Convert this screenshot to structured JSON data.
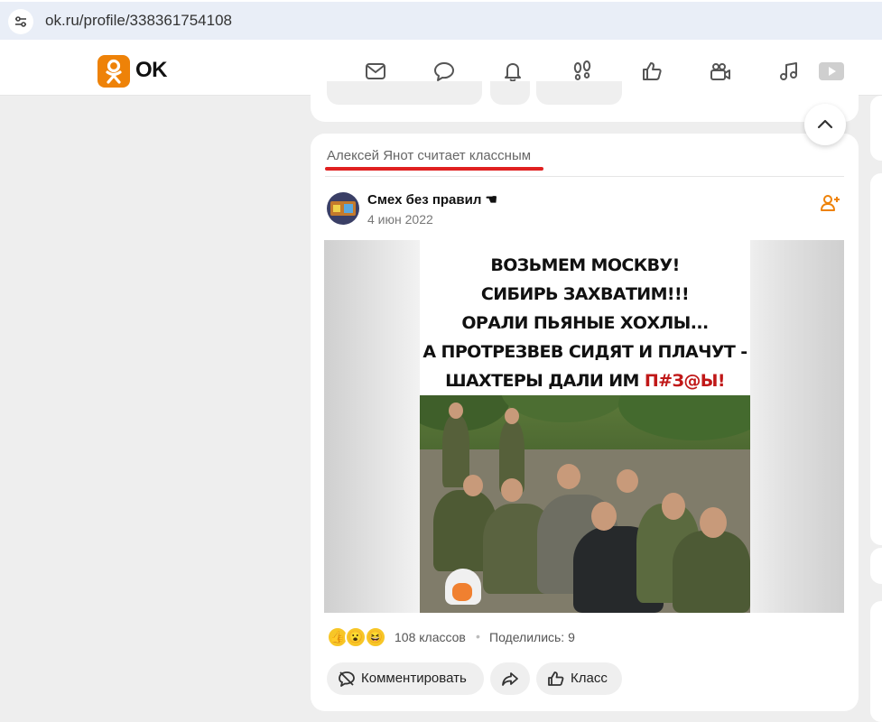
{
  "browser": {
    "url": "ok.ru/profile/338361754108",
    "site_info_icon": "tune-icon"
  },
  "header": {
    "logo_text": "OK",
    "brand_color": "#ee8208",
    "nav_icons": [
      "mail-icon",
      "chat-bubble-icon",
      "bell-icon",
      "footprints-icon",
      "thumbs-up-icon",
      "video-camera-icon",
      "music-note-icon",
      "video-play-icon"
    ]
  },
  "post": {
    "liked_by": "Алексей Янот считает классным",
    "group_name": "Смех без правил",
    "group_name_suffix": "☚",
    "date": "4 июн 2022",
    "image_caption_lines": [
      "ВОЗЬМЕМ МОСКВУ!",
      "СИБИРЬ ЗАХВАТИМ!!!",
      "ОРАЛИ ПЬЯНЫЕ ХОХЛЫ...",
      "А ПРОТРЕЗВЕВ СИДЯТ И ПЛАЧУТ -"
    ],
    "image_caption_last_plain": "ШАХТЕРЫ ДАЛИ ИМ ",
    "image_caption_last_red": "П#З@Ы!",
    "reactions": [
      "thumbs-up-emoji",
      "surprised-emoji",
      "laughing-emoji"
    ],
    "likes_count": "108 классов",
    "separator": "•",
    "shared": "Поделились: 9",
    "comment_label": "Комментировать",
    "class_label": "Класс",
    "accent_color": "#e02020"
  }
}
